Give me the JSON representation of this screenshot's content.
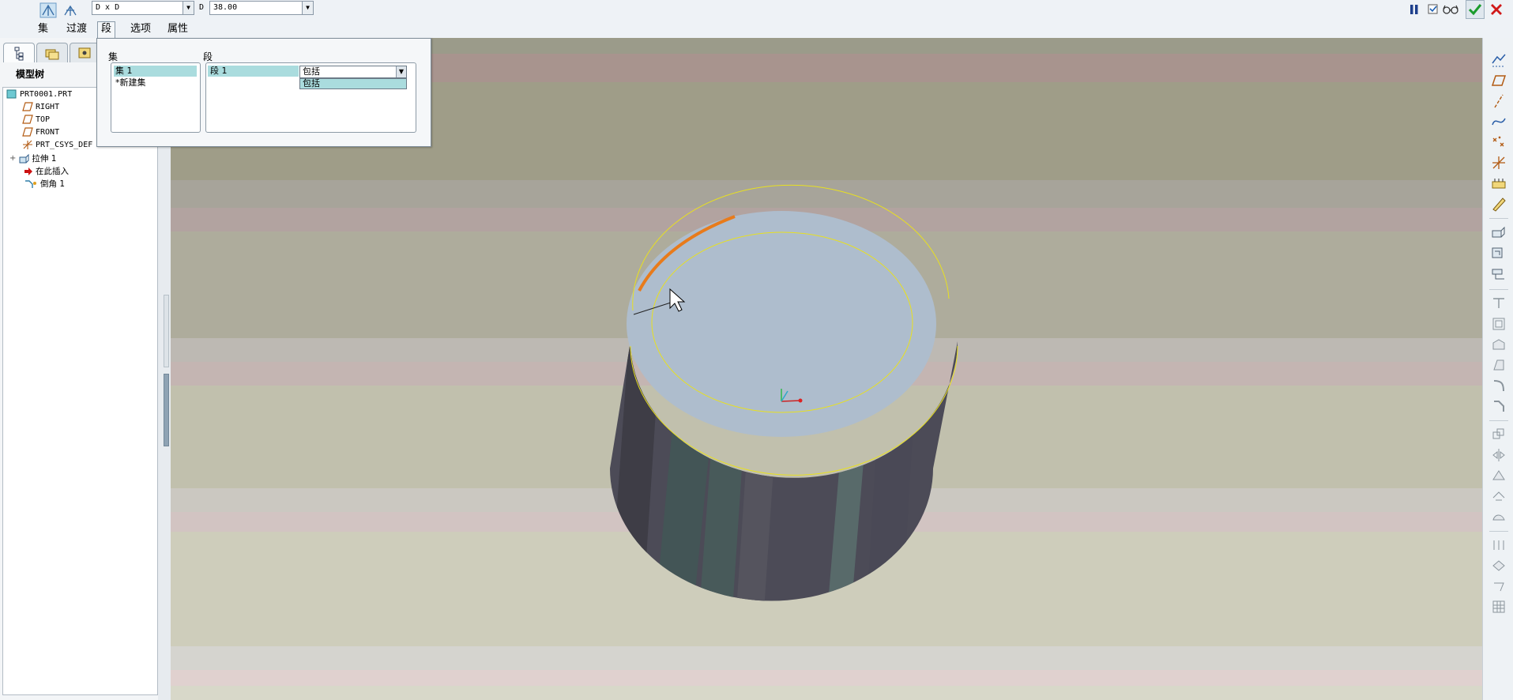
{
  "dashboard": {
    "reference_type": "D x D",
    "dimension_label": "D",
    "dimension_value": "38.00",
    "tabs": [
      "集",
      "过渡",
      "段",
      "选项",
      "属性"
    ],
    "active_tab": "段"
  },
  "left_panel": {
    "title": "模型树",
    "tree": [
      {
        "label": "PRT0001.PRT",
        "icon": "part-icon"
      },
      {
        "label": "RIGHT",
        "icon": "datum-plane-icon"
      },
      {
        "label": "TOP",
        "icon": "datum-plane-icon"
      },
      {
        "label": "FRONT",
        "icon": "datum-plane-icon"
      },
      {
        "label": "PRT_CSYS_DEF",
        "icon": "csys-icon"
      },
      {
        "label": "拉伸 1",
        "icon": "extrude-icon"
      },
      {
        "label": "在此插入",
        "icon": "insert-here-arrow-icon"
      },
      {
        "label": "倒角 1",
        "icon": "chamfer-icon"
      }
    ]
  },
  "segments_panel": {
    "sets_label": "集",
    "segments_label": "段",
    "sets": [
      "集 1",
      "*新建集"
    ],
    "segments": [
      "段 1"
    ],
    "segment_option": "包括",
    "dropdown_options": [
      "包括"
    ]
  },
  "colors": {
    "accent_selected": "#aadcde",
    "edge_highlight": "#e87b1b",
    "preview_curve": "#e8e020",
    "confirm_green": "#1a9c2c",
    "cancel_red": "#d01818"
  }
}
